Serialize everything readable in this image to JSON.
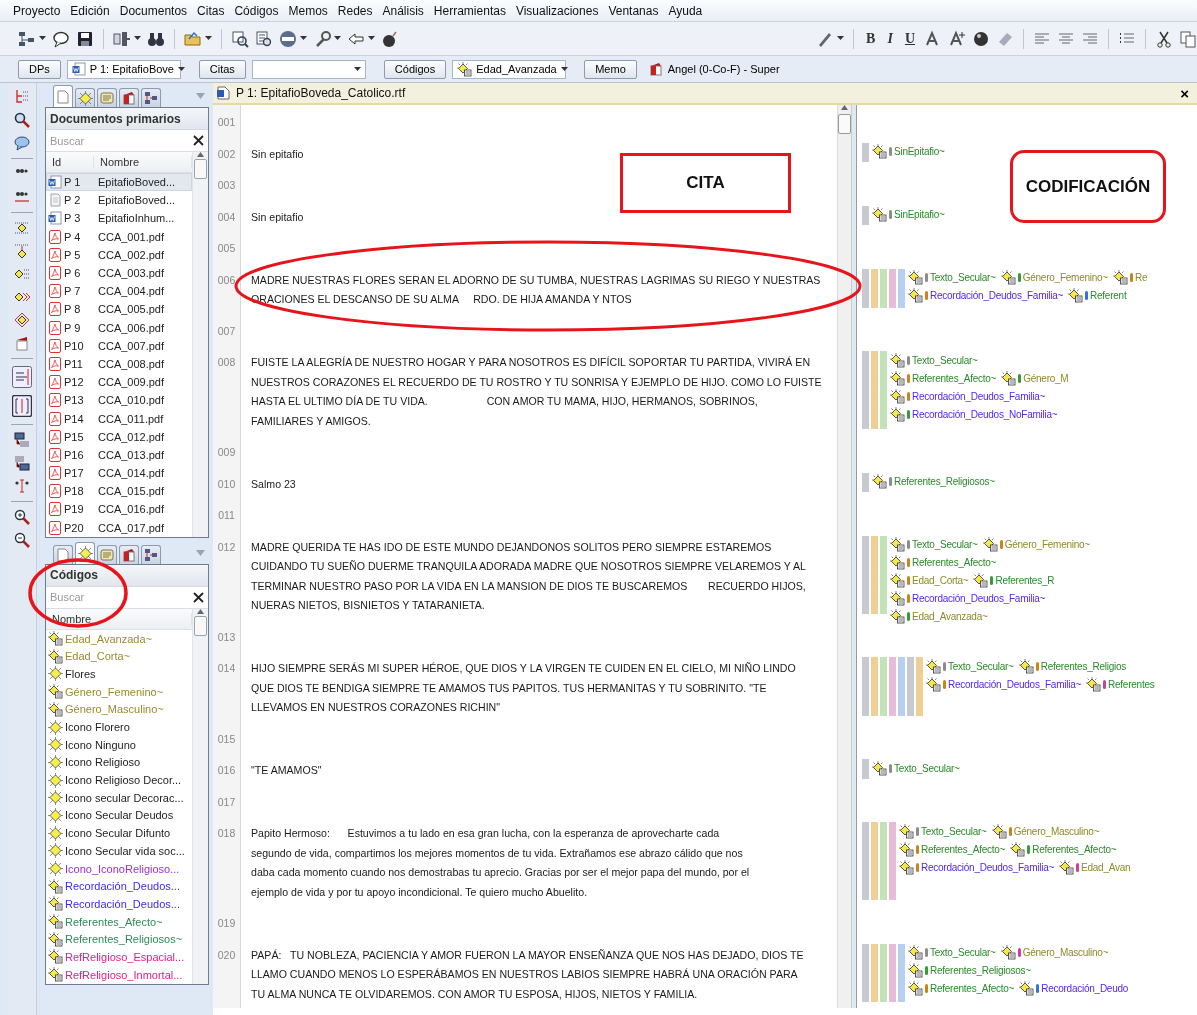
{
  "menu": [
    "Proyecto",
    "Edición",
    "Documentos",
    "Citas",
    "Códigos",
    "Memos",
    "Redes",
    "Análisis",
    "Herramientas",
    "Visualizaciones",
    "Ventanas",
    "Ayuda"
  ],
  "toolbar": {
    "format_buttons": [
      "B",
      "I",
      "U"
    ]
  },
  "selectors": [
    {
      "kind": "button",
      "label": "DPs"
    },
    {
      "kind": "dropdown",
      "value": "P 1: EpitafioBove"
    },
    {
      "kind": "button",
      "label": "Citas"
    },
    {
      "kind": "dropdown"
    },
    {
      "kind": "button",
      "label": "Códigos"
    },
    {
      "kind": "dropdown",
      "value": "Edad_Avanzada"
    },
    {
      "kind": "button",
      "label": "Memo"
    },
    {
      "kind": "text",
      "value": "Angel (0-Co-F) - Super"
    }
  ],
  "docs_panel": {
    "tabs": [
      {
        "selected": true
      },
      {
        "selected": false
      },
      {
        "selected": false
      },
      {
        "selected": false
      },
      {
        "selected": false
      }
    ],
    "title": "Documentos primarios",
    "search": {
      "placeholder": "Buscar"
    },
    "columns": [
      "Id",
      "Nombre"
    ],
    "rows": [
      {
        "kind": "word",
        "id": "P 1",
        "name": "EpitafioBoved...",
        "selected": true
      },
      {
        "kind": "text",
        "id": "P 2",
        "name": "EpitafioBoved...",
        "selected": false
      },
      {
        "kind": "word",
        "id": "P 3",
        "name": "EpitafioInhum...",
        "selected": false
      },
      {
        "kind": "pdf",
        "id": "P 4",
        "name": "CCA_001.pdf",
        "selected": false
      },
      {
        "kind": "pdf",
        "id": "P 5",
        "name": "CCA_002.pdf",
        "selected": false
      },
      {
        "kind": "pdf",
        "id": "P 6",
        "name": "CCA_003.pdf",
        "selected": false
      },
      {
        "kind": "pdf",
        "id": "P 7",
        "name": "CCA_004.pdf",
        "selected": false
      },
      {
        "kind": "pdf",
        "id": "P 8",
        "name": "CCA_005.pdf",
        "selected": false
      },
      {
        "kind": "pdf",
        "id": "P 9",
        "name": "CCA_006.pdf",
        "selected": false
      },
      {
        "kind": "pdf",
        "id": "P10",
        "name": "CCA_007.pdf",
        "selected": false
      },
      {
        "kind": "pdf",
        "id": "P11",
        "name": "CCA_008.pdf",
        "selected": false
      },
      {
        "kind": "pdf",
        "id": "P12",
        "name": "CCA_009.pdf",
        "selected": false
      },
      {
        "kind": "pdf",
        "id": "P13",
        "name": "CCA_010.pdf",
        "selected": false
      },
      {
        "kind": "pdf",
        "id": "P14",
        "name": "CCA_011.pdf",
        "selected": false
      },
      {
        "kind": "pdf",
        "id": "P15",
        "name": "CCA_012.pdf",
        "selected": false
      },
      {
        "kind": "pdf",
        "id": "P16",
        "name": "CCA_013.pdf",
        "selected": false
      },
      {
        "kind": "pdf",
        "id": "P17",
        "name": "CCA_014.pdf",
        "selected": false
      },
      {
        "kind": "pdf",
        "id": "P18",
        "name": "CCA_015.pdf",
        "selected": false
      },
      {
        "kind": "pdf",
        "id": "P19",
        "name": "CCA_016.pdf",
        "selected": false
      },
      {
        "kind": "pdf",
        "id": "P20",
        "name": "CCA_017.pdf",
        "selected": false
      }
    ]
  },
  "codes_panel": {
    "tabs": [
      {
        "selected": false
      },
      {
        "selected": true
      },
      {
        "selected": false
      },
      {
        "selected": false
      },
      {
        "selected": false
      }
    ],
    "title": "Códigos",
    "search": {
      "placeholder": "Buscar"
    },
    "columns": [
      "Nombre"
    ],
    "rows": [
      {
        "kind": "edad",
        "name": "Edad_Avanzada~"
      },
      {
        "kind": "edad",
        "name": "Edad_Corta~"
      },
      {
        "kind": "plain",
        "name": "Flores"
      },
      {
        "kind": "genero",
        "name": "Género_Femenino~"
      },
      {
        "kind": "genero",
        "name": "Género_Masculino~"
      },
      {
        "kind": "plain",
        "name": "Icono Florero"
      },
      {
        "kind": "plain",
        "name": "Icono Ninguno"
      },
      {
        "kind": "plain",
        "name": "Icono Religioso"
      },
      {
        "kind": "plain",
        "name": "Icono Religioso Decor..."
      },
      {
        "kind": "plain",
        "name": "Icono secular Decorac..."
      },
      {
        "kind": "plain",
        "name": "Icono Secular Deudos"
      },
      {
        "kind": "plain",
        "name": "Icono Secular Difunto"
      },
      {
        "kind": "plain",
        "name": "Icono Secular vida soc..."
      },
      {
        "kind": "icono_religioso",
        "name": "Icono_IconoReligioso..."
      },
      {
        "kind": "recordacion",
        "name": "Recordación_Deudos..."
      },
      {
        "kind": "recordacion",
        "name": "Recordación_Deudos..."
      },
      {
        "kind": "referentes",
        "name": "Referentes_Afecto~"
      },
      {
        "kind": "referentes",
        "name": "Referentes_Religiosos~"
      },
      {
        "kind": "refreligioso",
        "name": "RefReligioso_Espacial..."
      },
      {
        "kind": "refreligioso",
        "name": "RefReligioso_Inmortal..."
      }
    ]
  },
  "document": {
    "title": "P 1: EpitafioBoveda_Catolico.rtf",
    "close": "×",
    "paragraphs": [
      {
        "number": "001"
      },
      {
        "number": "002",
        "lines": [
          "Sin epitafio"
        ],
        "margin": {
          "bars": [
            {
              "color": "#c9c9d1"
            }
          ],
          "rows": [
            [
              {
                "kind": "green",
                "name": "SinEpitafio~",
                "color": "#8c8c8c"
              }
            ]
          ]
        }
      },
      {
        "number": "003"
      },
      {
        "number": "004",
        "lines": [
          "Sin epitafio"
        ],
        "margin": {
          "bars": [
            {
              "color": "#c9c9d1"
            }
          ],
          "rows": [
            [
              {
                "kind": "green",
                "name": "SinEpitafio~",
                "color": "#8c8c8c"
              }
            ]
          ]
        }
      },
      {
        "number": "005"
      },
      {
        "number": "006",
        "lines": [
          "MADRE NUESTRAS FLORES SERAN EL ADORNO DE SU TUMBA, NUESTRAS LAGRIMAS SU RIEGO Y NUESTRAS",
          "ORACIONES EL DESCANSO DE SU ALMA     RDO. DE HIJA AMANDA Y NTOS"
        ],
        "margin": {
          "bars": [
            {
              "color": "#c9c9d1"
            },
            {
              "color": "#f0cf94"
            },
            {
              "color": "#c2e3b8"
            },
            {
              "color": "#e8bcd8"
            },
            {
              "color": "#b8d0f0"
            }
          ],
          "rows": [
            [
              {
                "kind": "green",
                "name": "Texto_Secular~",
                "color": "#8c8c8c"
              },
              {
                "kind": "olive",
                "name": "Género_Femenino~",
                "color": "#3a9a3a"
              },
              {
                "kind": "olive",
                "name": "Re",
                "color": "#c8861a"
              }
            ],
            [
              {
                "kind": "blue",
                "name": "Recordación_Deudos_Familia~",
                "color": "#c8861a"
              },
              {
                "kind": "green",
                "name": "Referent",
                "color": "#3a6ee0"
              }
            ]
          ]
        }
      },
      {
        "number": "007"
      },
      {
        "number": "008",
        "lines": [
          "FUISTE LA ALEGRÍA DE NUESTRO HOGAR Y PARA NOSOTROS ES DIFÍCIL SOPORTAR TU PARTIDA, VIVIRÁ EN",
          "NUESTROS CORAZONES EL RECUERDO DE TU ROSTRO Y TU SONRISA Y EJEMPLO DE HIJO. COMO LO FUISTE",
          "HASTA EL ULTIMO DÍA DE TU VIDA.                    CON AMOR TU MAMA, HIJO, HERMANOS, SOBRINOS,",
          "FAMILIARES Y AMIGOS."
        ],
        "margin": {
          "bars": [
            {
              "color": "#c9c9d1"
            },
            {
              "color": "#f0cf94"
            },
            {
              "color": "#c2e3b8"
            }
          ],
          "rows": [
            [
              {
                "kind": "green",
                "name": "Texto_Secular~",
                "color": "#8c8c8c"
              }
            ],
            [
              {
                "kind": "green",
                "name": "Referentes_Afecto~",
                "color": "#c8861a"
              },
              {
                "kind": "olive",
                "name": "Género_M",
                "color": "#3a9a3a"
              }
            ],
            [
              {
                "kind": "blue",
                "name": "Recordación_Deudos_Familia~",
                "color": "#c8861a"
              }
            ],
            [
              {
                "kind": "blue",
                "name": "Recordación_Deudos_NoFamilia~",
                "color": "#3a9a3a"
              }
            ]
          ]
        }
      },
      {
        "number": "009"
      },
      {
        "number": "010",
        "lines": [
          "Salmo 23"
        ],
        "margin": {
          "bars": [
            {
              "color": "#c9c9d1"
            }
          ],
          "rows": [
            [
              {
                "kind": "green",
                "name": "Referentes_Religiosos~",
                "color": "#8c8c8c"
              }
            ]
          ]
        }
      },
      {
        "number": "011"
      },
      {
        "number": "012",
        "lines": [
          "MADRE QUERIDA TE HAS IDO DE ESTE MUNDO DEJANDONOS SOLITOS PERO SIEMPRE ESTAREMOS",
          "CUIDANDO TU SUEÑO DUERME TRANQUILA ADORADA MADRE QUE NOSOTROS SIEMPRE VELAREMOS Y AL",
          "TERMINAR NUESTRO PASO POR LA VIDA EN LA MANSION DE DIOS TE BUSCAREMOS       RECUERDO HIJOS,",
          "NUERAS NIETOS, BISNIETOS Y TATARANIETA."
        ],
        "margin": {
          "bars": [
            {
              "color": "#c9c9d1"
            },
            {
              "color": "#f0cf94"
            },
            {
              "color": "#c2e3b8"
            }
          ],
          "rows": [
            [
              {
                "kind": "green",
                "name": "Texto_Secular~",
                "color": "#8c8c8c"
              },
              {
                "kind": "olive",
                "name": "Género_Femenino~",
                "color": "#c8861a"
              }
            ],
            [
              {
                "kind": "green",
                "name": "Referentes_Afecto~",
                "color": "#c8861a"
              }
            ],
            [
              {
                "kind": "olive",
                "name": "Edad_Corta~",
                "color": "#c8861a"
              },
              {
                "kind": "green",
                "name": "Referentes_R",
                "color": "#3a9a3a"
              }
            ],
            [
              {
                "kind": "blue",
                "name": "Recordación_Deudos_Familia~",
                "color": "#c8861a"
              }
            ],
            [
              {
                "kind": "olive",
                "name": "Edad_Avanzada~",
                "color": "#3a9a3a"
              }
            ]
          ]
        }
      },
      {
        "number": "013"
      },
      {
        "number": "014",
        "lines": [
          "HIJO SIEMPRE SERÁS MI SUPER HÉROE, QUE DIOS Y LA VIRGEN TE CUIDEN EN EL CIELO, MI NIÑO LINDO",
          "QUE DIOS TE BENDIGA SIEMPRE TE AMAMOS TUS PAPITOS. TUS HERMANITAS Y TU SOBRINITO. \"TE",
          "LLEVAMOS EN NUESTROS CORAZONES RICHIN\""
        ],
        "margin": {
          "bars": [
            {
              "color": "#c9c9d1"
            },
            {
              "color": "#f0cf94"
            },
            {
              "color": "#c2e3b8"
            },
            {
              "color": "#e8bcd8"
            },
            {
              "color": "#b8d0f0"
            },
            {
              "color": "#c9c9d1"
            },
            {
              "color": "#f0cf94"
            }
          ],
          "rows": [
            [
              {
                "kind": "green",
                "name": "Texto_Secular~",
                "color": "#8c8c8c"
              },
              {
                "kind": "green",
                "name": "Referentes_Religios",
                "color": "#c8861a"
              }
            ],
            [
              {
                "kind": "blue",
                "name": "Recordación_Deudos_Familia~",
                "color": "#c8861a"
              },
              {
                "kind": "green",
                "name": "Referentes",
                "color": "#d0409a"
              }
            ]
          ]
        }
      },
      {
        "number": "015"
      },
      {
        "number": "016",
        "lines": [
          "\"TE AMAMOS\""
        ],
        "margin": {
          "bars": [
            {
              "color": "#c9c9d1"
            }
          ],
          "rows": [
            [
              {
                "kind": "green",
                "name": "Texto_Secular~",
                "color": "#8c8c8c"
              }
            ]
          ]
        }
      },
      {
        "number": "017"
      },
      {
        "number": "018",
        "lines": [
          "Papito Hermoso:      Estuvimos a tu lado en esa gran lucha, con la esperanza de aprovecharte cada",
          "segundo de vida, compartimos los mejores momentos de tu vida. Extrañamos ese abrazo cálido que nos",
          "daba cada momento cuando nos demostrabas tu aprecio. Gracias por ser el mejor papa del mundo, por el",
          "ejemplo de vida y por tu apoyo incondicional. Te quiero mucho Abuelito."
        ],
        "margin": {
          "bars": [
            {
              "color": "#c9c9d1"
            },
            {
              "color": "#f0cf94"
            },
            {
              "color": "#c2e3b8"
            },
            {
              "color": "#e8bcd8"
            }
          ],
          "rows": [
            [
              {
                "kind": "green",
                "name": "Texto_Secular~",
                "color": "#8c8c8c"
              },
              {
                "kind": "olive",
                "name": "Género_Masculino~",
                "color": "#c8861a"
              }
            ],
            [
              {
                "kind": "green",
                "name": "Referentes_Afecto~",
                "color": "#c8861a"
              },
              {
                "kind": "green",
                "name": "Referentes_Afecto~",
                "color": "#3a9a3a"
              }
            ],
            [
              {
                "kind": "blue",
                "name": "Recordación_Deudos_Familia~",
                "color": "#c8861a"
              },
              {
                "kind": "olive",
                "name": "Edad_Avan",
                "color": "#d0409a"
              }
            ]
          ]
        }
      },
      {
        "number": "019"
      },
      {
        "number": "020",
        "lines": [
          "PAPÁ:   TU NOBLEZA, PACIENCIA Y AMOR FUERON LA MAYOR ENSEÑANZA QUE NOS HAS DEJADO, DIOS TE",
          "LLAMO CUANDO MENOS LO ESPERÁBAMOS EN NUESTROS LABIOS SIEMPRE HABRÁ UNA ORACIÓN PARA",
          "TU ALMA NUNCA TE OLVIDAREMOS. CON AMOR TU ESPOSA, HIJOS, NIETOS Y FAMILIA."
        ],
        "margin": {
          "bars": [
            {
              "color": "#c9c9d1"
            },
            {
              "color": "#f0cf94"
            },
            {
              "color": "#c2e3b8"
            },
            {
              "color": "#e8bcd8"
            },
            {
              "color": "#b8d0f0"
            }
          ],
          "rows": [
            [
              {
                "kind": "green",
                "name": "Texto_Secular~",
                "color": "#8c8c8c"
              },
              {
                "kind": "olive",
                "name": "Género_Masculino~",
                "color": "#d0409a"
              }
            ],
            [
              {
                "kind": "green",
                "name": "Referentes_Religiosos~",
                "color": "#3a9a3a"
              }
            ],
            [
              {
                "kind": "green",
                "name": "Referentes_Afecto~",
                "color": "#c8861a"
              },
              {
                "kind": "blue",
                "name": "Recordación_Deudo",
                "color": "#3a6ee0"
              }
            ]
          ]
        }
      }
    ]
  },
  "callouts": [
    {
      "kind": "box",
      "text": "CITA"
    },
    {
      "kind": "rounded",
      "text": "CODIFICACIÓN"
    }
  ]
}
